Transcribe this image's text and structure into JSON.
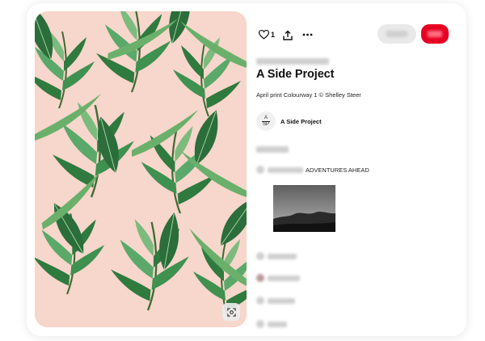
{
  "pin": {
    "title": "A Side Project",
    "description": "April print Colourway 1 © Shelley Steer",
    "likes": "1"
  },
  "creator": {
    "name": "A Side Project",
    "logo_top": "A",
    "logo_bottom": "SP"
  },
  "comment": {
    "text": "ADVENTURES AHEAD"
  },
  "colors": {
    "save_red": "#e60023",
    "background_pink": "#f7d6cb",
    "leaf_green": "#2f7a3e"
  },
  "icons": {
    "like": "heart-outline-icon",
    "share": "share-upload-icon",
    "more": "ellipsis-icon",
    "lens": "visual-search-icon"
  }
}
